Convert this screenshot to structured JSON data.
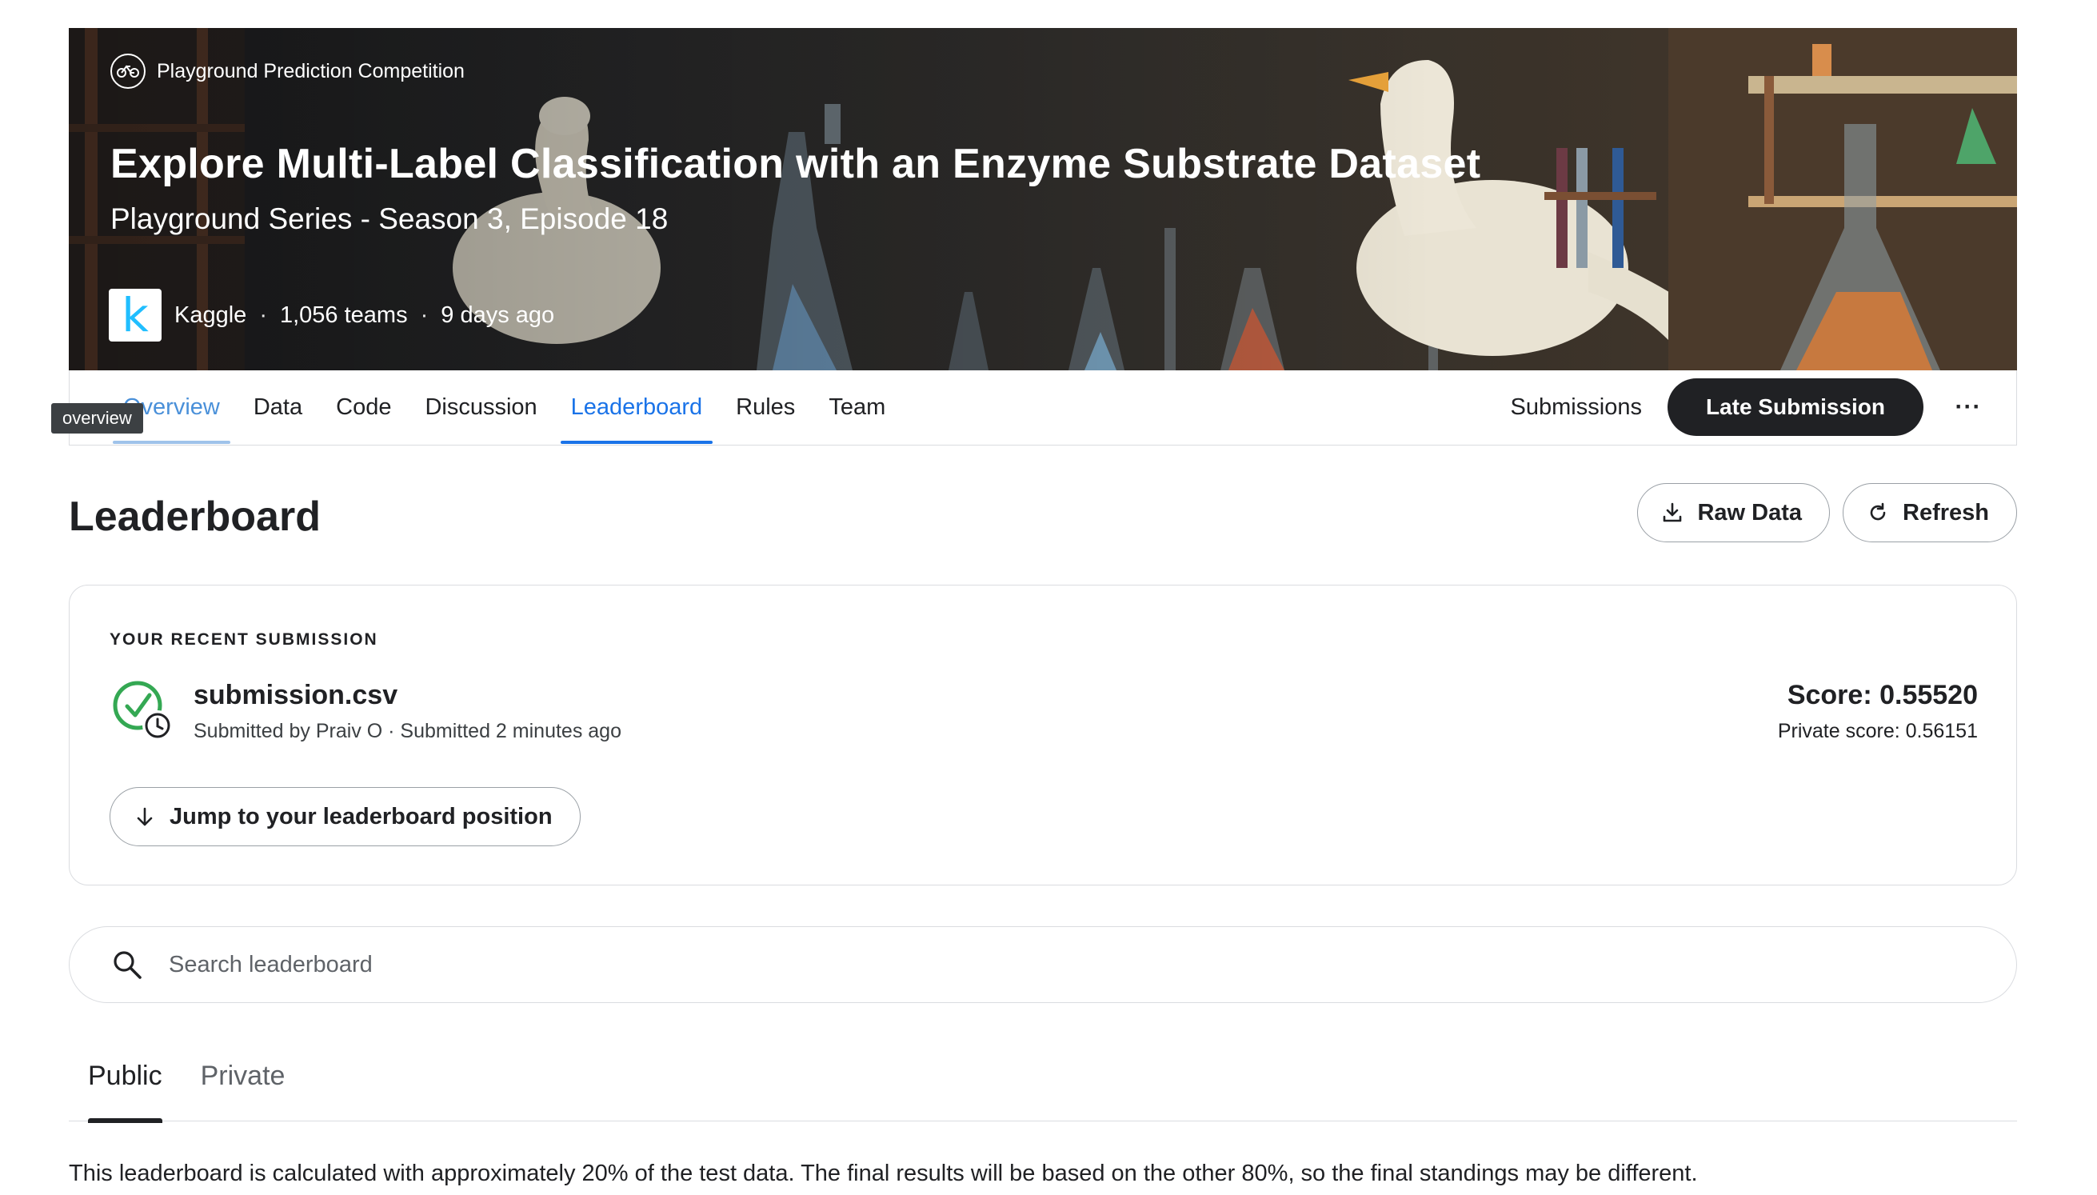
{
  "hero": {
    "tag": "Playground Prediction Competition",
    "title": "Explore Multi-Label Classification with an Enzyme Substrate Dataset",
    "subtitle": "Playground Series - Season 3, Episode 18",
    "host": "Kaggle",
    "logo_letter": "k",
    "teams": "1,056 teams",
    "time_ago": "9 days ago",
    "separator": "·"
  },
  "nav": {
    "tabs": [
      {
        "label": "Overview",
        "state": "hovered"
      },
      {
        "label": "Data",
        "state": "normal"
      },
      {
        "label": "Code",
        "state": "normal"
      },
      {
        "label": "Discussion",
        "state": "normal"
      },
      {
        "label": "Leaderboard",
        "state": "active"
      },
      {
        "label": "Rules",
        "state": "normal"
      },
      {
        "label": "Team",
        "state": "normal"
      }
    ],
    "tooltip": "overview",
    "submissions_label": "Submissions",
    "late_submission_label": "Late Submission",
    "more_label": "···"
  },
  "header": {
    "title": "Leaderboard",
    "raw_data_label": "Raw Data",
    "refresh_label": "Refresh"
  },
  "recent_submission": {
    "section_label": "YOUR RECENT SUBMISSION",
    "file_name": "submission.csv",
    "meta": "Submitted by Praiv O · Submitted 2 minutes ago",
    "score": "Score: 0.55520",
    "private_score": "Private score: 0.56151",
    "jump_label": "Jump to your leaderboard position"
  },
  "search": {
    "placeholder": "Search leaderboard",
    "value": ""
  },
  "leaderboard_tabs": {
    "public": "Public",
    "private": "Private",
    "active": "Public"
  },
  "note": "This leaderboard is calculated with approximately 20% of the test data. The final results will be based on the other 80%, so the final standings may be different.",
  "colors": {
    "accent": "#1a73e8",
    "dark_button": "#202124",
    "success": "#34a853",
    "border": "#dadce0"
  }
}
